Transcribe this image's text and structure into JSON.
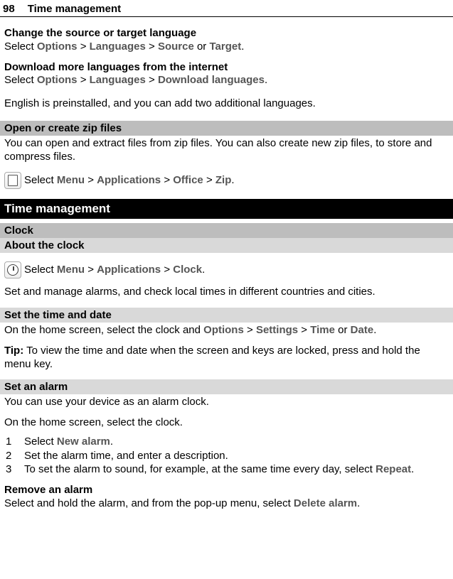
{
  "header": {
    "page_num": "98",
    "section": "Time management"
  },
  "lang": {
    "change_heading": "Change the source or target language",
    "change_select": "Select ",
    "options": "Options",
    "gt1": " > ",
    "languages": "Languages",
    "gt2": " > ",
    "source": "Source",
    "or": " or ",
    "target": "Target",
    "period": ".",
    "download_heading": "Download more languages from the internet",
    "download_select": "Select ",
    "download_lang": "Download languages",
    "note": "English is preinstalled, and you can add two additional languages."
  },
  "zip": {
    "bar": "Open or create zip files",
    "intro": "You can open and extract files from zip files. You can also create new zip files, to store and compress files.",
    "select": " Select ",
    "menu": "Menu",
    "gt1": " > ",
    "apps": "Applications",
    "gt2": " > ",
    "office": "Office",
    "gt3": " > ",
    "zip": "Zip",
    "period": "."
  },
  "tm": {
    "bar_chapter": "Time management",
    "bar_clock": "Clock",
    "bar_about": "About the clock",
    "select": " Select ",
    "menu": "Menu",
    "gt1": " > ",
    "apps": "Applications",
    "gt2": " > ",
    "clock": "Clock",
    "period": ".",
    "desc": "Set and manage alarms, and check local times in different countries and cities."
  },
  "settime": {
    "bar": "Set the time and date",
    "line_pre": "On the home screen, select the clock and ",
    "options": "Options",
    "gt1": " > ",
    "settings": "Settings",
    "gt2": " > ",
    "time": "Time",
    "or": " or ",
    "date": "Date",
    "period": ".",
    "tip_label": "Tip:",
    "tip_text": " To view the time and date when the screen and keys are locked, press and hold the menu key."
  },
  "alarm": {
    "bar": "Set an alarm",
    "intro": "You can use your device as an alarm clock.",
    "home": "On the home screen, select the clock.",
    "step1_pre": "Select ",
    "step1_term": "New alarm",
    "step1_post": ".",
    "step2": "Set the alarm time, and enter a description.",
    "step3_pre": "To set the alarm to sound, for example, at the same time every day, select ",
    "step3_term": "Repeat",
    "step3_post": ".",
    "remove_heading": "Remove an alarm",
    "remove_pre": "Select and hold the alarm, and from the pop-up menu, select ",
    "remove_term": "Delete alarm",
    "remove_post": "."
  }
}
